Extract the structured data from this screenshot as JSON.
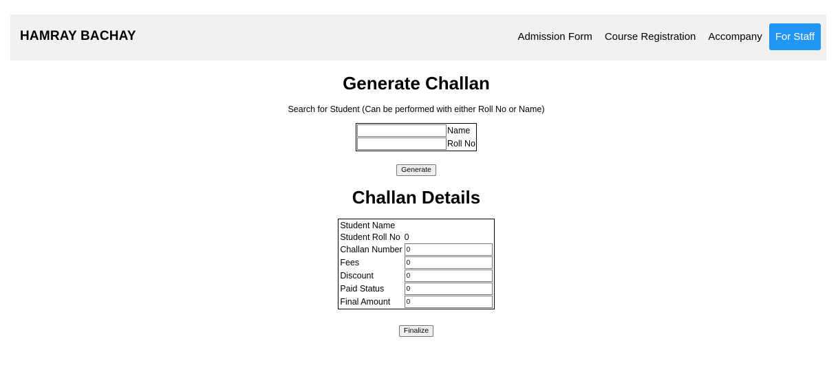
{
  "brand": "HAMRAY BACHAY",
  "nav": {
    "admission": "Admission Form",
    "course": "Course Registration",
    "accompany": "Accompany",
    "staff": "For Staff"
  },
  "generate": {
    "title": "Generate Challan",
    "note": "Search for Student (Can be performed with either Roll No or Name)",
    "name_label": "Name",
    "name_value": "",
    "roll_label": "Roll No",
    "roll_value": "",
    "button": "Generate"
  },
  "details": {
    "title": "Challan Details",
    "student_name_label": "Student Name",
    "student_name_value": "",
    "student_roll_label": "Student Roll No",
    "student_roll_value": "0",
    "challan_number_label": "Challan Number",
    "challan_number_value": "0",
    "fees_label": "Fees",
    "fees_value": "0",
    "discount_label": "Discount",
    "discount_value": "0",
    "paid_status_label": "Paid Status",
    "paid_status_value": "0",
    "final_amount_label": "Final Amount",
    "final_amount_value": "0",
    "button": "Finalize"
  },
  "colors": {
    "accent": "#2196F3",
    "navbar_bg": "#f1f1f1"
  }
}
